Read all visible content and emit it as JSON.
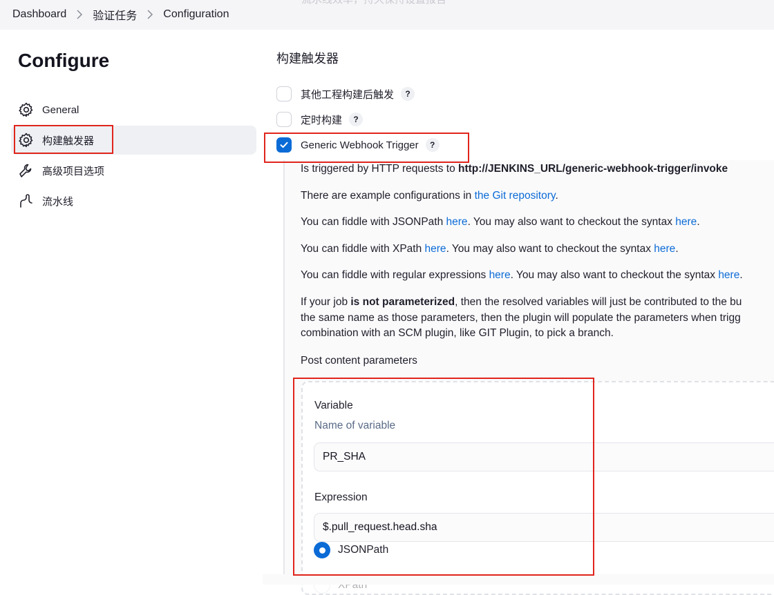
{
  "ghost_text": "流水线效率，持久保持设置报告",
  "breadcrumb": {
    "items": [
      "Dashboard",
      "验证任务",
      "Configuration"
    ]
  },
  "page_title": "Configure",
  "sidebar": {
    "items": [
      {
        "label": "General",
        "icon": "gear-icon",
        "active": false
      },
      {
        "label": "构建触发器",
        "icon": "gear-icon",
        "active": true
      },
      {
        "label": "高级项目选项",
        "icon": "wrench-icon",
        "active": false
      },
      {
        "label": "流水线",
        "icon": "pipeline-icon",
        "active": false
      }
    ]
  },
  "main": {
    "section_title": "构建触发器",
    "triggers": [
      {
        "label": "其他工程构建后触发",
        "checked": false,
        "help": "?"
      },
      {
        "label": "定时构建",
        "checked": false,
        "help": "?"
      },
      {
        "label": "Generic Webhook Trigger",
        "checked": true,
        "help": "?"
      }
    ],
    "description": {
      "p1_prefix": "Is triggered by HTTP requests to ",
      "p1_url": "http://JENKINS_URL/generic-webhook-trigger/invoke",
      "p2_prefix": "There are example configurations in ",
      "p2_link": "the Git repository",
      "p2_suffix": ".",
      "p3_prefix": "You can fiddle with JSONPath ",
      "p3_link1": "here",
      "p3_mid": ". You may also want to checkout the syntax ",
      "p3_link2": "here",
      "p3_suffix": ".",
      "p4_prefix": "You can fiddle with XPath ",
      "p4_link1": "here",
      "p4_mid": ". You may also want to checkout the syntax ",
      "p4_link2": "here",
      "p4_suffix": ".",
      "p5_prefix": "You can fiddle with regular expressions ",
      "p5_link1": "here",
      "p5_mid": ". You may also want to checkout the syntax ",
      "p5_link2": "here",
      "p5_suffix": ".",
      "p6_line1_prefix": "If your job ",
      "p6_line1_bold": "is not parameterized",
      "p6_line1_rest": ", then the resolved variables will just be contributed to the bu",
      "p6_line2": "the same name as those parameters, then the plugin will populate the parameters when trigg",
      "p6_line3": "combination with an SCM plugin, like GIT Plugin, to pick a branch."
    },
    "post_content_title": "Post content parameters",
    "variable": {
      "label": "Variable",
      "sublabel": "Name of variable",
      "value": "PR_SHA"
    },
    "expression": {
      "label": "Expression",
      "value": "$.pull_request.head.sha",
      "options": [
        {
          "label": "JSONPath",
          "selected": true
        },
        {
          "label": "XPath",
          "selected": false
        }
      ]
    }
  },
  "colors": {
    "accent": "#0b6bd6",
    "annotation_red": "#e0241b",
    "active_bg": "#eef0f3"
  }
}
